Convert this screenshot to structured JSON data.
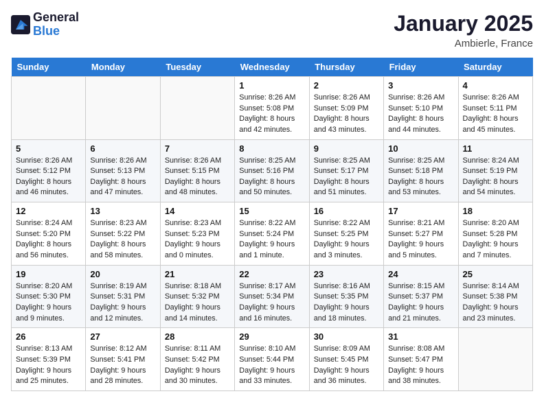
{
  "header": {
    "logo_line1": "General",
    "logo_line2": "Blue",
    "month": "January 2025",
    "location": "Ambierle, France"
  },
  "weekdays": [
    "Sunday",
    "Monday",
    "Tuesday",
    "Wednesday",
    "Thursday",
    "Friday",
    "Saturday"
  ],
  "weeks": [
    [
      {
        "day": "",
        "info": ""
      },
      {
        "day": "",
        "info": ""
      },
      {
        "day": "",
        "info": ""
      },
      {
        "day": "1",
        "info": "Sunrise: 8:26 AM\nSunset: 5:08 PM\nDaylight: 8 hours\nand 42 minutes."
      },
      {
        "day": "2",
        "info": "Sunrise: 8:26 AM\nSunset: 5:09 PM\nDaylight: 8 hours\nand 43 minutes."
      },
      {
        "day": "3",
        "info": "Sunrise: 8:26 AM\nSunset: 5:10 PM\nDaylight: 8 hours\nand 44 minutes."
      },
      {
        "day": "4",
        "info": "Sunrise: 8:26 AM\nSunset: 5:11 PM\nDaylight: 8 hours\nand 45 minutes."
      }
    ],
    [
      {
        "day": "5",
        "info": "Sunrise: 8:26 AM\nSunset: 5:12 PM\nDaylight: 8 hours\nand 46 minutes."
      },
      {
        "day": "6",
        "info": "Sunrise: 8:26 AM\nSunset: 5:13 PM\nDaylight: 8 hours\nand 47 minutes."
      },
      {
        "day": "7",
        "info": "Sunrise: 8:26 AM\nSunset: 5:15 PM\nDaylight: 8 hours\nand 48 minutes."
      },
      {
        "day": "8",
        "info": "Sunrise: 8:25 AM\nSunset: 5:16 PM\nDaylight: 8 hours\nand 50 minutes."
      },
      {
        "day": "9",
        "info": "Sunrise: 8:25 AM\nSunset: 5:17 PM\nDaylight: 8 hours\nand 51 minutes."
      },
      {
        "day": "10",
        "info": "Sunrise: 8:25 AM\nSunset: 5:18 PM\nDaylight: 8 hours\nand 53 minutes."
      },
      {
        "day": "11",
        "info": "Sunrise: 8:24 AM\nSunset: 5:19 PM\nDaylight: 8 hours\nand 54 minutes."
      }
    ],
    [
      {
        "day": "12",
        "info": "Sunrise: 8:24 AM\nSunset: 5:20 PM\nDaylight: 8 hours\nand 56 minutes."
      },
      {
        "day": "13",
        "info": "Sunrise: 8:23 AM\nSunset: 5:22 PM\nDaylight: 8 hours\nand 58 minutes."
      },
      {
        "day": "14",
        "info": "Sunrise: 8:23 AM\nSunset: 5:23 PM\nDaylight: 9 hours\nand 0 minutes."
      },
      {
        "day": "15",
        "info": "Sunrise: 8:22 AM\nSunset: 5:24 PM\nDaylight: 9 hours\nand 1 minute."
      },
      {
        "day": "16",
        "info": "Sunrise: 8:22 AM\nSunset: 5:25 PM\nDaylight: 9 hours\nand 3 minutes."
      },
      {
        "day": "17",
        "info": "Sunrise: 8:21 AM\nSunset: 5:27 PM\nDaylight: 9 hours\nand 5 minutes."
      },
      {
        "day": "18",
        "info": "Sunrise: 8:20 AM\nSunset: 5:28 PM\nDaylight: 9 hours\nand 7 minutes."
      }
    ],
    [
      {
        "day": "19",
        "info": "Sunrise: 8:20 AM\nSunset: 5:30 PM\nDaylight: 9 hours\nand 9 minutes."
      },
      {
        "day": "20",
        "info": "Sunrise: 8:19 AM\nSunset: 5:31 PM\nDaylight: 9 hours\nand 12 minutes."
      },
      {
        "day": "21",
        "info": "Sunrise: 8:18 AM\nSunset: 5:32 PM\nDaylight: 9 hours\nand 14 minutes."
      },
      {
        "day": "22",
        "info": "Sunrise: 8:17 AM\nSunset: 5:34 PM\nDaylight: 9 hours\nand 16 minutes."
      },
      {
        "day": "23",
        "info": "Sunrise: 8:16 AM\nSunset: 5:35 PM\nDaylight: 9 hours\nand 18 minutes."
      },
      {
        "day": "24",
        "info": "Sunrise: 8:15 AM\nSunset: 5:37 PM\nDaylight: 9 hours\nand 21 minutes."
      },
      {
        "day": "25",
        "info": "Sunrise: 8:14 AM\nSunset: 5:38 PM\nDaylight: 9 hours\nand 23 minutes."
      }
    ],
    [
      {
        "day": "26",
        "info": "Sunrise: 8:13 AM\nSunset: 5:39 PM\nDaylight: 9 hours\nand 25 minutes."
      },
      {
        "day": "27",
        "info": "Sunrise: 8:12 AM\nSunset: 5:41 PM\nDaylight: 9 hours\nand 28 minutes."
      },
      {
        "day": "28",
        "info": "Sunrise: 8:11 AM\nSunset: 5:42 PM\nDaylight: 9 hours\nand 30 minutes."
      },
      {
        "day": "29",
        "info": "Sunrise: 8:10 AM\nSunset: 5:44 PM\nDaylight: 9 hours\nand 33 minutes."
      },
      {
        "day": "30",
        "info": "Sunrise: 8:09 AM\nSunset: 5:45 PM\nDaylight: 9 hours\nand 36 minutes."
      },
      {
        "day": "31",
        "info": "Sunrise: 8:08 AM\nSunset: 5:47 PM\nDaylight: 9 hours\nand 38 minutes."
      },
      {
        "day": "",
        "info": ""
      }
    ]
  ]
}
